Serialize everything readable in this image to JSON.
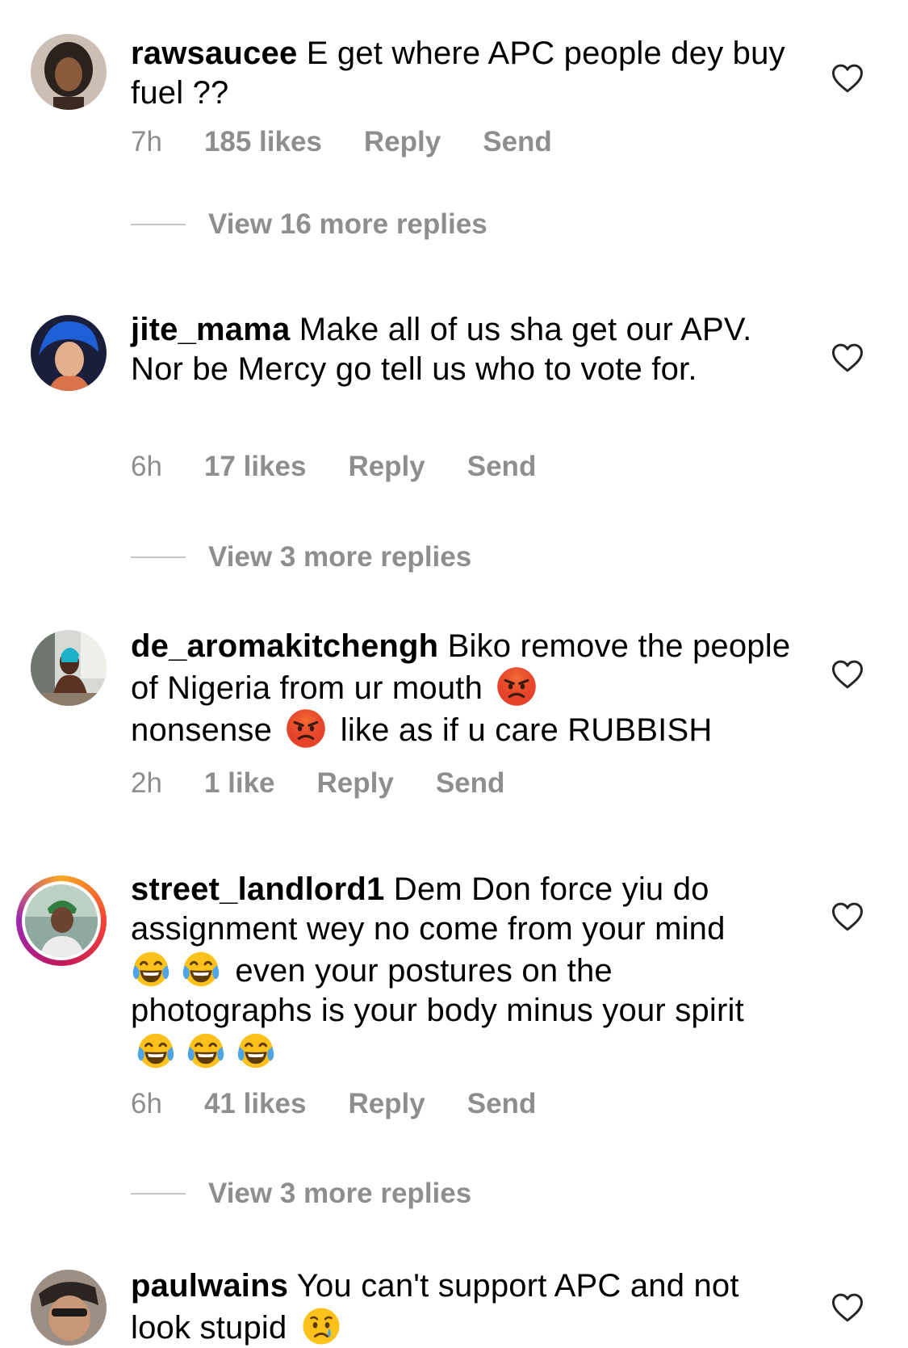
{
  "comments": [
    {
      "username": "rawsaucee",
      "parts": [
        "E get where APC people dey buy fuel ??"
      ],
      "time": "7h",
      "likes": "185 likes",
      "reply": "Reply",
      "send": "Send",
      "view_replies": "View 16 more replies"
    },
    {
      "username": "jite_mama",
      "parts": [
        "Make all of us sha get our APV. Nor be Mercy go tell us who to vote for."
      ],
      "time": "6h",
      "likes": "17 likes",
      "reply": "Reply",
      "send": "Send",
      "view_replies": "View 3 more replies"
    },
    {
      "username": "de_aromakitchengh",
      "parts": [
        "Biko remove the people of Nigeria from ur mouth",
        "nonsense",
        "like as if u care  RUBBISH"
      ],
      "time": "2h",
      "likes": "1 like",
      "reply": "Reply",
      "send": "Send"
    },
    {
      "username": "street_landlord1",
      "parts": [
        "Dem Don force yiu do assignment wey no come from your mind",
        "even your postures on the photographs is your body minus your spirit"
      ],
      "time": "6h",
      "likes": "41 likes",
      "reply": "Reply",
      "send": "Send",
      "view_replies": "View 3 more replies"
    },
    {
      "username": "paulwains",
      "parts": [
        "You can't support APC and not look stupid"
      ]
    }
  ],
  "icons": {
    "heart": "heart-outline-icon",
    "angry": "angry-face-emoji",
    "laughing": "tears-of-joy-emoji",
    "crying": "crying-face-emoji"
  },
  "colors": {
    "meta_text": "#8e8e8e",
    "divider": "#c7c7c7"
  }
}
